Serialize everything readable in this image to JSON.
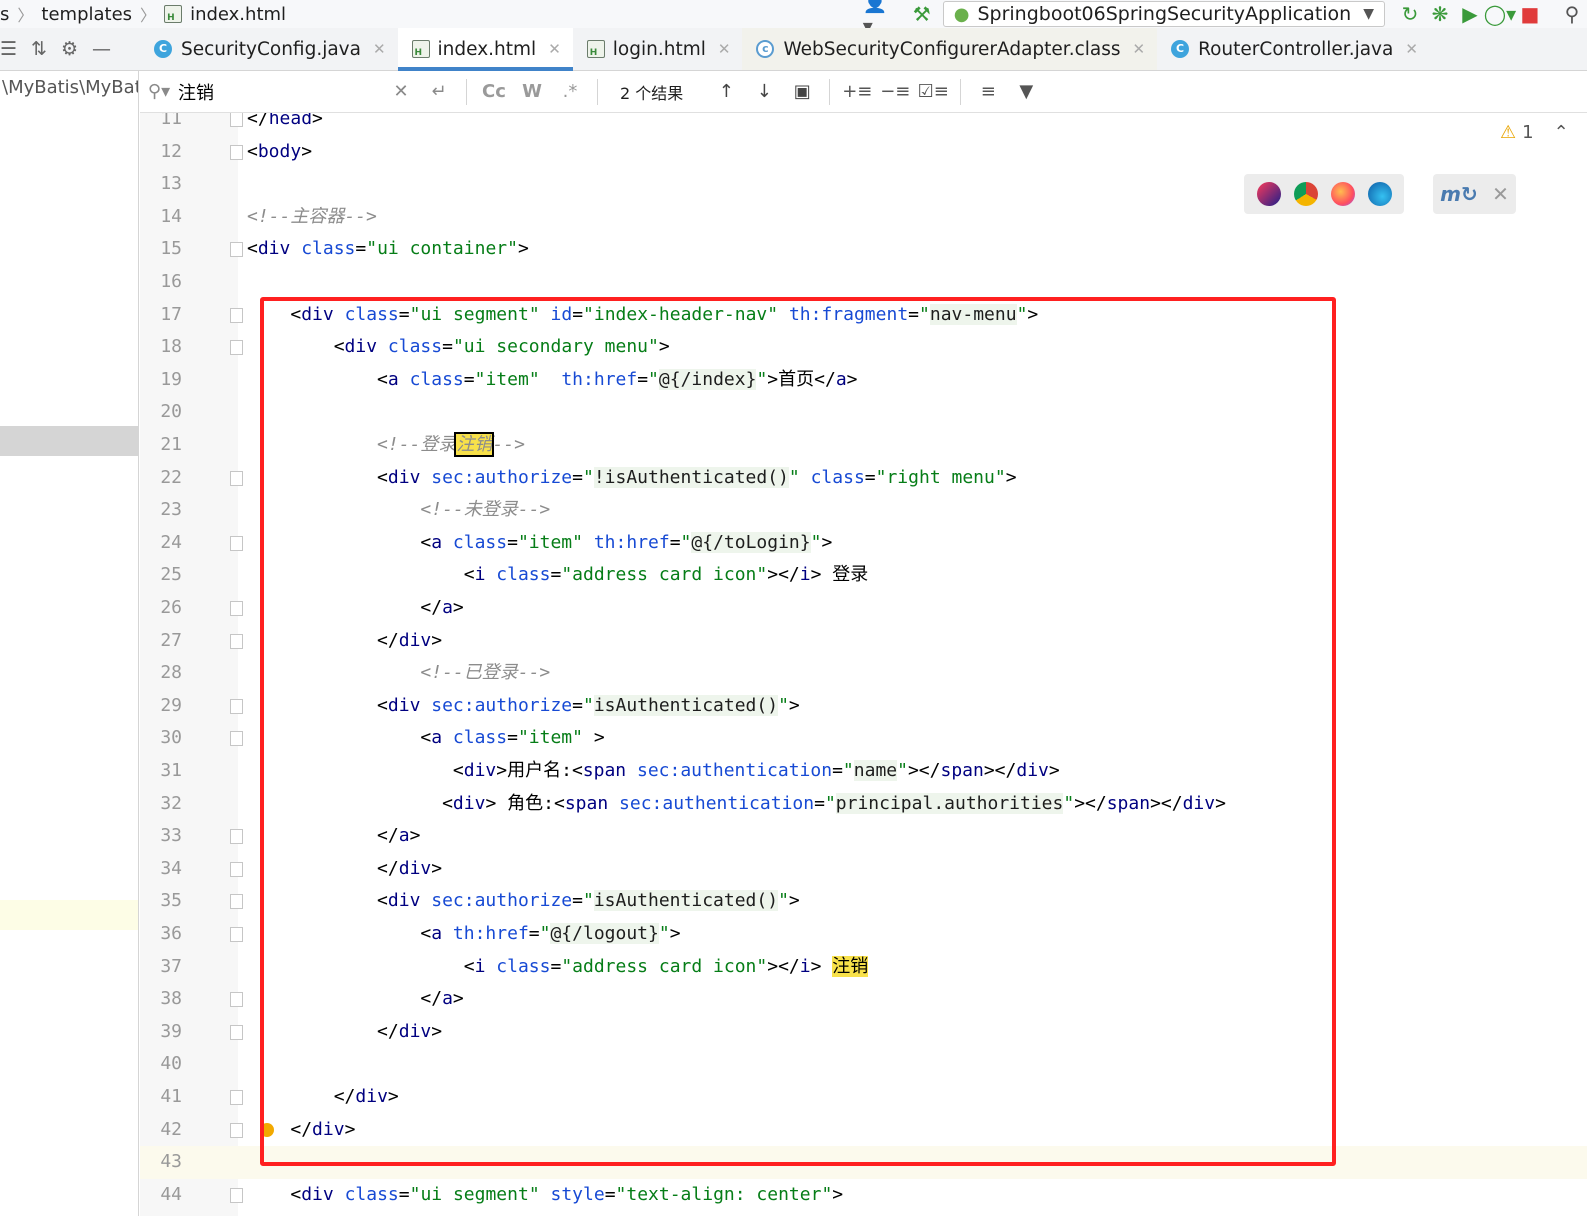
{
  "navbar": {
    "breadcrumb_prev": "s",
    "breadcrumb_folder": "templates",
    "breadcrumb_file": "index.html",
    "run_config": "Springboot06SpringSecurityApplication"
  },
  "left_panel": {
    "path_text": "\\MyBatis\\MyBat"
  },
  "tabs": [
    {
      "label": "SecurityConfig.java",
      "kind": "class"
    },
    {
      "label": "index.html",
      "kind": "html"
    },
    {
      "label": "login.html",
      "kind": "html"
    },
    {
      "label": "WebSecurityConfigurerAdapter.class",
      "kind": "abstract"
    },
    {
      "label": "RouterController.java",
      "kind": "class"
    }
  ],
  "search": {
    "query": "注销",
    "results": "2 个结果",
    "opt_case": "Cc",
    "opt_word": "W",
    "opt_regex": ".*"
  },
  "editor": {
    "warning_count": "1",
    "lines": [
      {
        "n": "11",
        "t": "</head>"
      },
      {
        "n": "12",
        "t": "<body>"
      },
      {
        "n": "13",
        "t": ""
      },
      {
        "n": "14",
        "t": "<!--主容器-->"
      },
      {
        "n": "15",
        "t": "<div class=\"ui container\">"
      },
      {
        "n": "16",
        "t": ""
      },
      {
        "n": "17",
        "t": "    <div class=\"ui segment\" id=\"index-header-nav\" th:fragment=\"nav-menu\">"
      },
      {
        "n": "18",
        "t": "        <div class=\"ui secondary menu\">"
      },
      {
        "n": "19",
        "t": "            <a class=\"item\"  th:href=\"@{/index}\">首页</a>"
      },
      {
        "n": "20",
        "t": ""
      },
      {
        "n": "21",
        "t": "            <!--登录注销-->"
      },
      {
        "n": "22",
        "t": "            <div sec:authorize=\"!isAuthenticated()\" class=\"right menu\">"
      },
      {
        "n": "23",
        "t": "                <!--未登录-->"
      },
      {
        "n": "24",
        "t": "                <a class=\"item\" th:href=\"@{/toLogin}\">"
      },
      {
        "n": "25",
        "t": "                    <i class=\"address card icon\"></i> 登录"
      },
      {
        "n": "26",
        "t": "                </a>"
      },
      {
        "n": "27",
        "t": "            </div>"
      },
      {
        "n": "28",
        "t": "                <!--已登录-->"
      },
      {
        "n": "29",
        "t": "            <div sec:authorize=\"isAuthenticated()\">"
      },
      {
        "n": "30",
        "t": "                <a class=\"item\" >"
      },
      {
        "n": "31",
        "t": "                   <div>用户名:<span sec:authentication=\"name\"></span></div>"
      },
      {
        "n": "32",
        "t": "                  <div> 角色:<span sec:authentication=\"principal.authorities\"></span></div>"
      },
      {
        "n": "33",
        "t": "            </a>"
      },
      {
        "n": "34",
        "t": "            </div>"
      },
      {
        "n": "35",
        "t": "            <div sec:authorize=\"isAuthenticated()\">"
      },
      {
        "n": "36",
        "t": "                <a th:href=\"@{/logout}\">"
      },
      {
        "n": "37",
        "t": "                    <i class=\"address card icon\"></i> 注销"
      },
      {
        "n": "38",
        "t": "                </a>"
      },
      {
        "n": "39",
        "t": "            </div>"
      },
      {
        "n": "40",
        "t": ""
      },
      {
        "n": "41",
        "t": "        </div>"
      },
      {
        "n": "42",
        "t": "    </div>"
      },
      {
        "n": "43",
        "t": ""
      },
      {
        "n": "44",
        "t": "    <div class=\"ui segment\" style=\"text-align: center\">"
      }
    ]
  },
  "colors": {
    "annotation_box": "#ff2020",
    "search_highlight": "#f8e14a",
    "active_tab_underline": "#4083c9"
  }
}
